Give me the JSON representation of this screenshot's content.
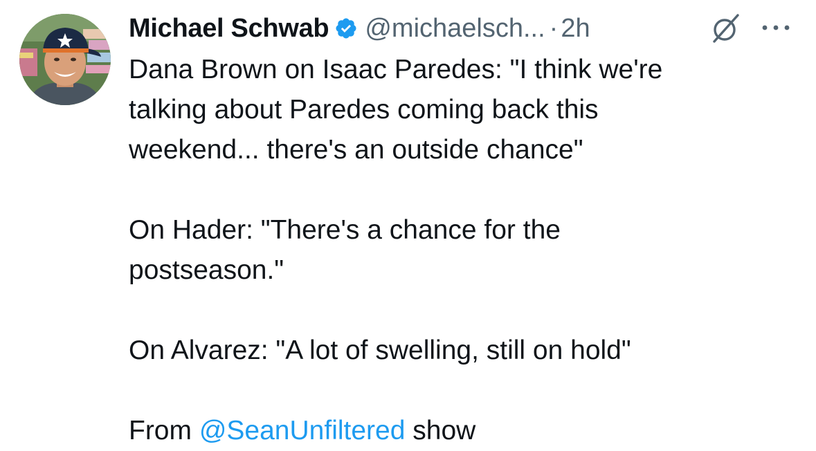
{
  "tweet": {
    "author": {
      "display_name": "Michael Schwab",
      "handle": "@michaelsch...",
      "verified": true,
      "avatar_icon": "profile-photo-astros-cap"
    },
    "separator": "·",
    "time": "2h",
    "actions": {
      "grok_icon": "grok-icon",
      "more_icon": "more-dots-icon"
    },
    "text_lines": [
      "Dana Brown on Isaac Paredes: \"I think we're",
      "talking about Paredes coming back this",
      "weekend... there's an outside chance\"",
      "",
      "On Hader: \"There's a chance for the",
      "postseason.\"",
      "",
      "On Alvarez: \"A lot of swelling, still on hold\"",
      ""
    ],
    "last_line": {
      "prefix": "From ",
      "mention": "@SeanUnfiltered",
      "suffix": " show"
    }
  },
  "colors": {
    "text": "#0f1419",
    "secondary": "#536471",
    "link": "#1d9bf0",
    "verified": "#1d9bf0"
  }
}
